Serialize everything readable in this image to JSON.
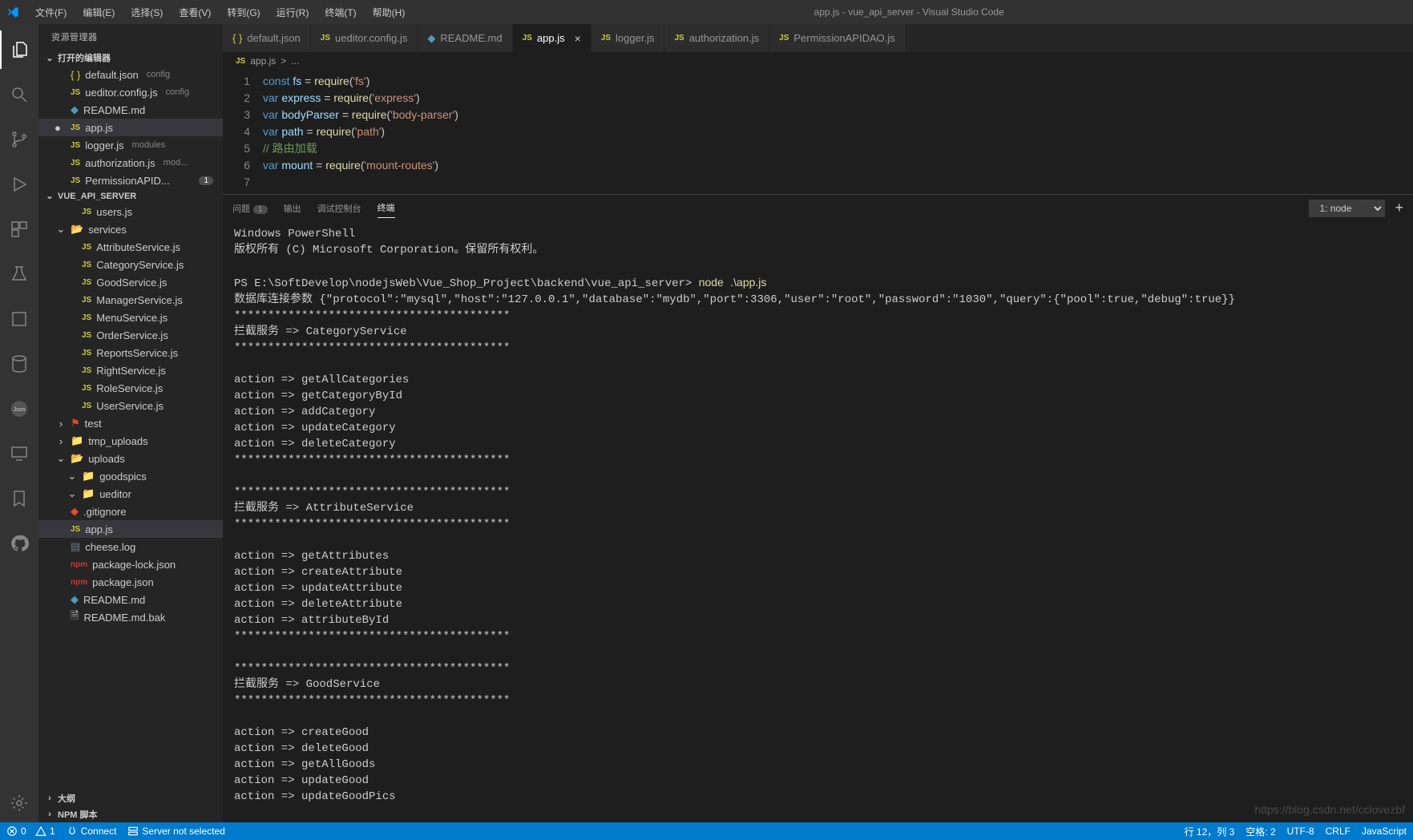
{
  "title_center": "app.js - vue_api_server - Visual Studio Code",
  "menubar": [
    "文件(F)",
    "编辑(E)",
    "选择(S)",
    "查看(V)",
    "转到(G)",
    "运行(R)",
    "终端(T)",
    "帮助(H)"
  ],
  "sidebar_title": "资源管理器",
  "sections": {
    "open_editors_label": "打开的编辑器",
    "project_label": "VUE_API_SERVER",
    "outline_label": "大纲",
    "npm_label": "NPM 脚本"
  },
  "open_editors": [
    {
      "icon": "json",
      "name": "default.json",
      "hint": "config"
    },
    {
      "icon": "js",
      "name": "ueditor.config.js",
      "hint": "config"
    },
    {
      "icon": "md",
      "name": "README.md",
      "hint": ""
    },
    {
      "icon": "js",
      "name": "app.js",
      "hint": "",
      "active": true,
      "modified": true
    },
    {
      "icon": "js",
      "name": "logger.js",
      "hint": "modules"
    },
    {
      "icon": "js",
      "name": "authorization.js",
      "hint": "mod..."
    },
    {
      "icon": "js",
      "name": "PermissionAPID...",
      "hint": "",
      "badge": "1"
    }
  ],
  "tree": [
    {
      "depth": 2,
      "icon": "js",
      "name": "users.js"
    },
    {
      "depth": 1,
      "icon": "folder-open",
      "name": "services",
      "chev": "v"
    },
    {
      "depth": 2,
      "icon": "js",
      "name": "AttributeService.js"
    },
    {
      "depth": 2,
      "icon": "js",
      "name": "CategoryService.js"
    },
    {
      "depth": 2,
      "icon": "js",
      "name": "GoodService.js"
    },
    {
      "depth": 2,
      "icon": "js",
      "name": "ManagerService.js"
    },
    {
      "depth": 2,
      "icon": "js",
      "name": "MenuService.js"
    },
    {
      "depth": 2,
      "icon": "js",
      "name": "OrderService.js"
    },
    {
      "depth": 2,
      "icon": "js",
      "name": "ReportsService.js"
    },
    {
      "depth": 2,
      "icon": "js",
      "name": "RightService.js"
    },
    {
      "depth": 2,
      "icon": "js",
      "name": "RoleService.js"
    },
    {
      "depth": 2,
      "icon": "js",
      "name": "UserService.js"
    },
    {
      "depth": 1,
      "icon": "folder-red",
      "name": "test",
      "chev": ">"
    },
    {
      "depth": 1,
      "icon": "folder",
      "name": "tmp_uploads",
      "chev": ">"
    },
    {
      "depth": 1,
      "icon": "folder-open",
      "name": "uploads",
      "chev": "v"
    },
    {
      "depth": 2,
      "icon": "folder",
      "name": "goodspics",
      "chev": "v"
    },
    {
      "depth": 2,
      "icon": "folder",
      "name": "ueditor",
      "chev": "v"
    },
    {
      "depth": 1,
      "icon": "git",
      "name": ".gitignore"
    },
    {
      "depth": 1,
      "icon": "js",
      "name": "app.js",
      "active": true
    },
    {
      "depth": 1,
      "icon": "log",
      "name": "cheese.log"
    },
    {
      "depth": 1,
      "icon": "npm",
      "name": "package-lock.json"
    },
    {
      "depth": 1,
      "icon": "npm",
      "name": "package.json"
    },
    {
      "depth": 1,
      "icon": "md",
      "name": "README.md"
    },
    {
      "depth": 1,
      "icon": "generic",
      "name": "README.md.bak"
    }
  ],
  "tabs": [
    {
      "icon": "json",
      "label": "default.json"
    },
    {
      "icon": "js",
      "label": "ueditor.config.js"
    },
    {
      "icon": "md",
      "label": "README.md"
    },
    {
      "icon": "js",
      "label": "app.js",
      "active": true,
      "close": true
    },
    {
      "icon": "js",
      "label": "logger.js"
    },
    {
      "icon": "js",
      "label": "authorization.js"
    },
    {
      "icon": "js",
      "label": "PermissionAPIDAO.js"
    }
  ],
  "breadcrumb": {
    "file": "app.js",
    "sep": ">",
    "rest": "..."
  },
  "code": [
    {
      "n": 1,
      "html": "<span class='kw'>const</span> <span class='var'>fs</span> = <span class='fn'>require</span>(<span class='str'>'fs'</span>)"
    },
    {
      "n": 2,
      "html": "<span class='kw'>var</span> <span class='var'>express</span> = <span class='fn'>require</span>(<span class='str'>'express'</span>)"
    },
    {
      "n": 3,
      "html": "<span class='kw'>var</span> <span class='var'>bodyParser</span> = <span class='fn'>require</span>(<span class='str'>'body-parser'</span>)"
    },
    {
      "n": 4,
      "html": "<span class='kw'>var</span> <span class='var'>path</span> = <span class='fn'>require</span>(<span class='str'>'path'</span>)"
    },
    {
      "n": 5,
      "html": "<span class='cm'>// 路由加载</span>"
    },
    {
      "n": 6,
      "html": "<span class='kw'>var</span> <span class='var'>mount</span> = <span class='fn'>require</span>(<span class='str'>'mount-routes'</span>)"
    },
    {
      "n": 7,
      "html": ""
    }
  ],
  "panel_tabs": {
    "problems": "问题",
    "problems_count": "1",
    "output": "输出",
    "debug": "调试控制台",
    "terminal": "终端"
  },
  "terminal_selector": "1: node",
  "terminal_lines": [
    "Windows PowerShell",
    "版权所有 (C) Microsoft Corporation。保留所有权利。",
    "",
    "PS E:\\SoftDevelop\\nodejsWeb\\Vue_Shop_Project\\backend\\vue_api_server> node .\\app.js",
    "数据库连接参数 {\"protocol\":\"mysql\",\"host\":\"127.0.0.1\",\"database\":\"mydb\",\"port\":3306,\"user\":\"root\",\"password\":\"1030\",\"query\":{\"pool\":true,\"debug\":true}}",
    "*****************************************",
    "拦截服务 => CategoryService",
    "*****************************************",
    "",
    "action => getAllCategories",
    "action => getCategoryById",
    "action => addCategory",
    "action => updateCategory",
    "action => deleteCategory",
    "*****************************************",
    "",
    "*****************************************",
    "拦截服务 => AttributeService",
    "*****************************************",
    "",
    "action => getAttributes",
    "action => createAttribute",
    "action => updateAttribute",
    "action => deleteAttribute",
    "action => attributeById",
    "*****************************************",
    "",
    "*****************************************",
    "拦截服务 => GoodService",
    "*****************************************",
    "",
    "action => createGood",
    "action => deleteGood",
    "action => getAllGoods",
    "action => updateGood",
    "action => updateGoodPics"
  ],
  "status": {
    "errors": "0",
    "warnings": "1",
    "connect": "Connect",
    "server": "Server not selected",
    "pos": "行 12，列 3",
    "spaces": "空格: 2",
    "enc": "UTF-8",
    "eol": "CRLF",
    "lang": "JavaScript"
  },
  "watermark": "https://blog.csdn.net/cclovezbf"
}
